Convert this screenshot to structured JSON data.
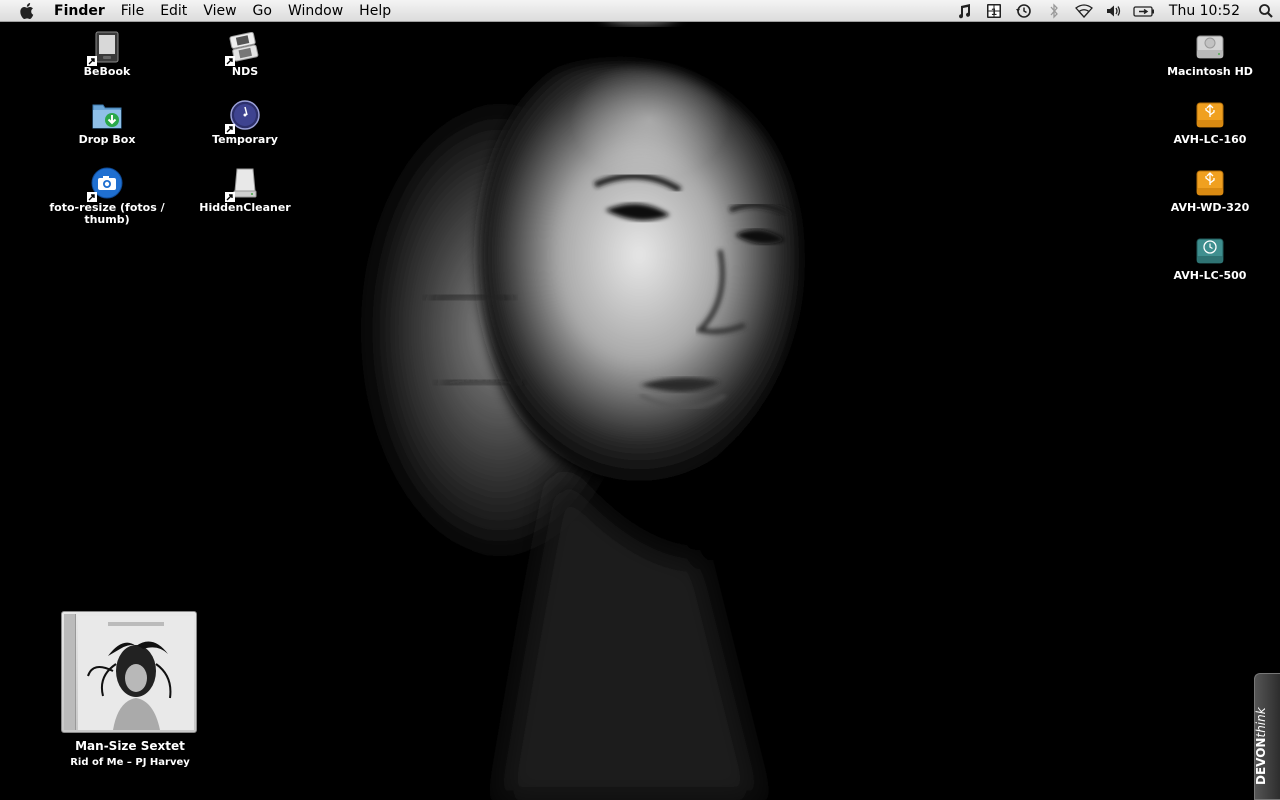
{
  "menubar": {
    "app_name": "Finder",
    "menus": [
      "File",
      "Edit",
      "View",
      "Go",
      "Window",
      "Help"
    ],
    "status_icons": [
      "music-icon",
      "spaces-icon",
      "time-machine-icon",
      "bluetooth-icon",
      "wifi-icon",
      "volume-icon",
      "battery-icon"
    ],
    "clock": "Thu 10:52"
  },
  "desktop": {
    "left_icons": [
      {
        "label": "BeBook",
        "icon": "ebook-reader-icon"
      },
      {
        "label": "NDS",
        "icon": "nintendo-ds-icon"
      },
      {
        "label": "Drop Box",
        "icon": "dropbox-folder-icon"
      },
      {
        "label": "Temporary",
        "icon": "clock-icon"
      },
      {
        "label": "foto-resize (fotos / thumb)",
        "icon": "camera-icon"
      },
      {
        "label": "HiddenCleaner",
        "icon": "drive-icon"
      }
    ],
    "volumes": [
      {
        "label": "Macintosh HD",
        "icon": "hard-drive-icon"
      },
      {
        "label": "AVH-LC-160",
        "icon": "usb-drive-icon"
      },
      {
        "label": "AVH-WD-320",
        "icon": "usb-drive-icon"
      },
      {
        "label": "AVH-LC-500",
        "icon": "time-machine-drive-icon"
      }
    ]
  },
  "now_playing": {
    "track": "Man-Size Sextet",
    "album_artist": "Rid of Me – PJ Harvey"
  },
  "devonthink": {
    "brand_bold": "DEVON",
    "brand_italic": "think"
  },
  "colors": {
    "menubar": "#e6e6e6",
    "desktop": "#000000",
    "usb_drive": "#f0a020",
    "time_machine_drive": "#3f8f8f"
  }
}
